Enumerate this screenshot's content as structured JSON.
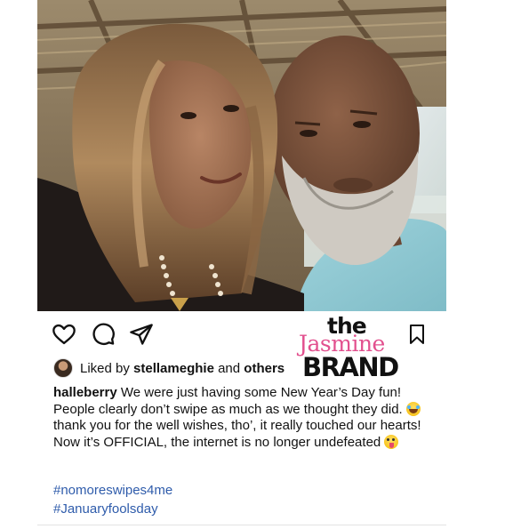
{
  "post": {
    "photo": {
      "alt": ""
    },
    "actions": {
      "like_icon": "heart-icon",
      "comment_icon": "comment-icon",
      "share_icon": "paper-plane-icon",
      "save_icon": "bookmark-icon"
    },
    "likes": {
      "prefix": "Liked by ",
      "user": "stellameghie",
      "middle": " and ",
      "others": "others"
    },
    "caption": {
      "username": "halleberry",
      "line1": " We were just having some New Year’s Day fun! People clearly don’t swipe as much as we thought they did. ",
      "line2": " thank you for the well wishes, tho’, it really touched our hearts! Now it’s OFFICIAL, the internet is no longer undefeated ",
      "emoji1": "face-with-tears-of-joy-emoji",
      "emoji2": "winking-face-with-tongue-emoji"
    },
    "hashtags": [
      "#nomoreswipes4me",
      "#Januaryfoolsday"
    ]
  },
  "watermark": {
    "the": "the",
    "jasmine": "Jasmine",
    "brand": "BRAND"
  },
  "colors": {
    "hashtag": "#2f5cab",
    "watermark_pink": "#e2508e",
    "text": "#111111"
  }
}
